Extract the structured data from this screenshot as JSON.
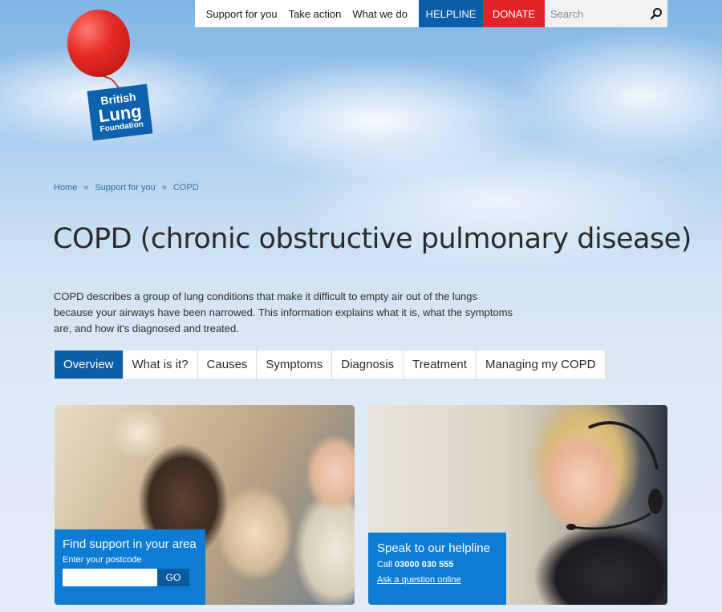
{
  "nav": {
    "links": [
      "Support for you",
      "Take action",
      "What we do"
    ],
    "helpline_label": "HELPLINE",
    "donate_label": "DONATE",
    "search_placeholder": "Search"
  },
  "logo": {
    "line1": "British",
    "line2": "Lung",
    "line3": "Foundation"
  },
  "breadcrumb": [
    "Home",
    "Support for you",
    "COPD"
  ],
  "breadcrumb_separator": "»",
  "page_title": "COPD (chronic obstructive pulmonary disease)",
  "intro": "COPD describes a group of lung conditions that make it difficult to empty air out of the lungs because your airways have been narrowed. This information explains what it is, what the symptoms are, and how it's diagnosed and treated.",
  "tabs": [
    "Overview",
    "What is it?",
    "Causes",
    "Symptoms",
    "Diagnosis",
    "Treatment",
    "Managing my COPD"
  ],
  "active_tab": "Overview",
  "cards": {
    "find_support": {
      "title": "Find support in your area",
      "label": "Enter your postcode",
      "input_value": "",
      "button": "GO"
    },
    "helpline": {
      "title": "Speak to our helpline",
      "call_prefix": "Call",
      "phone": "03000 030 555",
      "link": "Ask a question online"
    }
  },
  "colors": {
    "brand_blue": "#0b5ea8",
    "panel_blue": "#0d7cd4",
    "donate_red": "#e32329"
  }
}
